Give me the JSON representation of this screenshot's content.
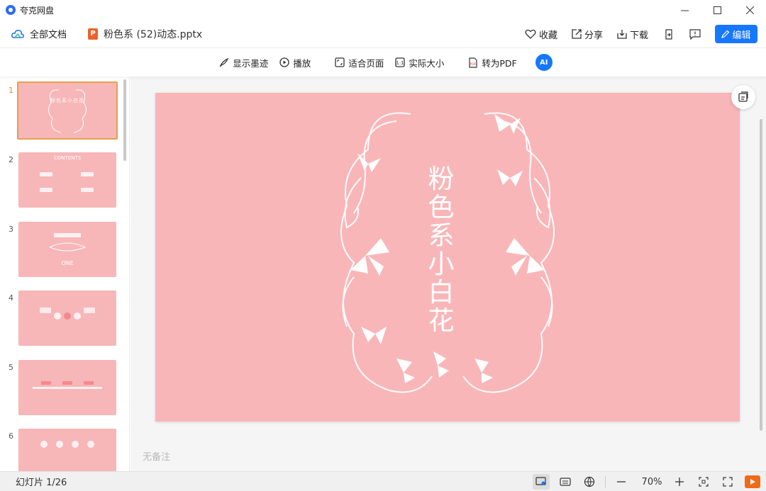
{
  "window": {
    "title": "夸克网盘",
    "minimize": "—",
    "maximize": "☐",
    "close": "✕"
  },
  "filebar": {
    "all_docs": "全部文档",
    "file_badge": "P",
    "file_name": "粉色系 (52)动态.pptx",
    "favorite": "收藏",
    "share": "分享",
    "download": "下载",
    "edit": "编辑"
  },
  "toolbar": {
    "ink": "显示墨迹",
    "play": "播放",
    "fit_page": "适合页面",
    "actual_size": "实际大小",
    "to_pdf": "转为PDF",
    "ai": "AI"
  },
  "thumbnails": [
    {
      "num": "1",
      "label": "粉色系小白花"
    },
    {
      "num": "2",
      "label": "CONTENTS"
    },
    {
      "num": "3",
      "label": "ONE"
    },
    {
      "num": "4",
      "label": ""
    },
    {
      "num": "5",
      "label": ""
    },
    {
      "num": "6",
      "label": ""
    }
  ],
  "slide": {
    "title": "粉色系小白花",
    "bg_color": "#f9b6b8"
  },
  "notes_placeholder": "无备注",
  "status": {
    "slide_count": "幻灯片 1/26",
    "zoom": "70%",
    "zoom_out": "—",
    "zoom_in": "+"
  },
  "colors": {
    "accent": "#1677ff",
    "active_thumb": "#e2a14f",
    "ppt": "#e8632b",
    "play": "#ef6a19"
  }
}
